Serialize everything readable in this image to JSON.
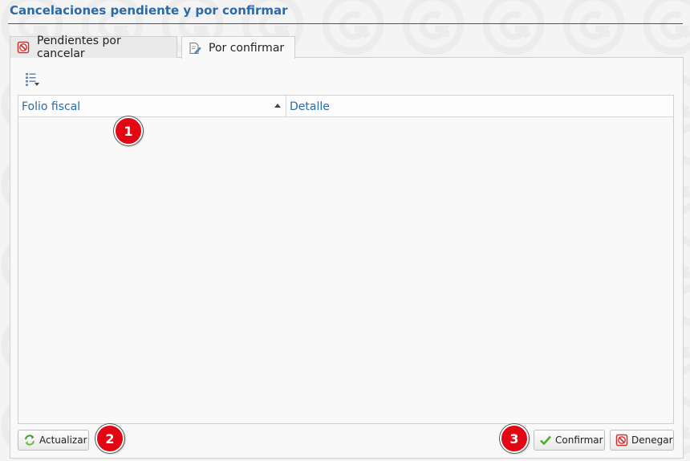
{
  "page": {
    "title": "Cancelaciones pendiente y por confirmar"
  },
  "tabs": [
    {
      "label": "Pendientes por cancelar",
      "icon": "cancel-doc-icon",
      "active": false
    },
    {
      "label": "Por confirmar",
      "icon": "edit-doc-icon",
      "active": true
    }
  ],
  "toolbar": {
    "icon": "column-chooser-icon"
  },
  "grid": {
    "columns": [
      {
        "label": "Folio fiscal",
        "sort": "ascending"
      },
      {
        "label": "Detalle"
      }
    ],
    "rows": []
  },
  "buttons": {
    "refresh_label": "Actualizar",
    "confirm_label": "Confirmar",
    "deny_label": "Denegar"
  },
  "badges": [
    "1",
    "2",
    "3"
  ],
  "colors": {
    "title": "#2a6aa8",
    "badge": "#e30613",
    "header_text": "#2a6aa8"
  }
}
